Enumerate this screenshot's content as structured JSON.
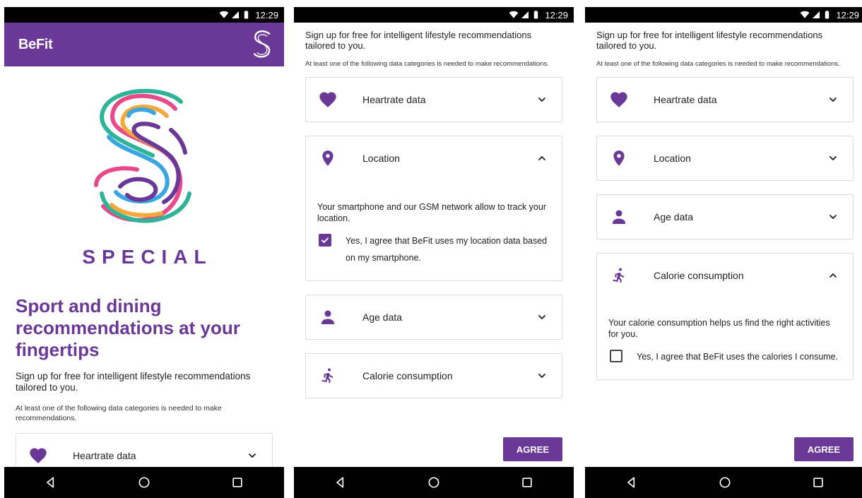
{
  "status_bar": {
    "time": "12:29"
  },
  "app": {
    "title": "BeFit",
    "brand_word": "SPECIAL",
    "accent_color": "#6a3896"
  },
  "onboarding": {
    "hero_title": "Sport and dining recommendations at your fingertips",
    "lead": "Sign up for free for intelligent lifestyle recommendations tailored to you.",
    "note": "At least one of the following data categories is needed to make recommendations."
  },
  "categories": {
    "heartrate": {
      "label": "Heartrate data",
      "icon": "heart-icon"
    },
    "location": {
      "label": "Location",
      "icon": "location-pin-icon",
      "description": "Your smartphone and our GSM network allow to track your location.",
      "consent": "Yes, I agree that BeFit uses my location data based on my smartphone.",
      "consent_checked": true
    },
    "age": {
      "label": "Age data",
      "icon": "person-icon"
    },
    "calorie": {
      "label": "Calorie consumption",
      "icon": "runner-icon",
      "description": "Your calorie consumption helps us find the right activities for you.",
      "consent": "Yes, I agree that BeFit uses the calories I consume.",
      "consent_checked": false
    }
  },
  "actions": {
    "agree_label": "AGREE"
  },
  "nav": {
    "back": "back-icon",
    "home": "home-icon",
    "recents": "recents-icon"
  }
}
